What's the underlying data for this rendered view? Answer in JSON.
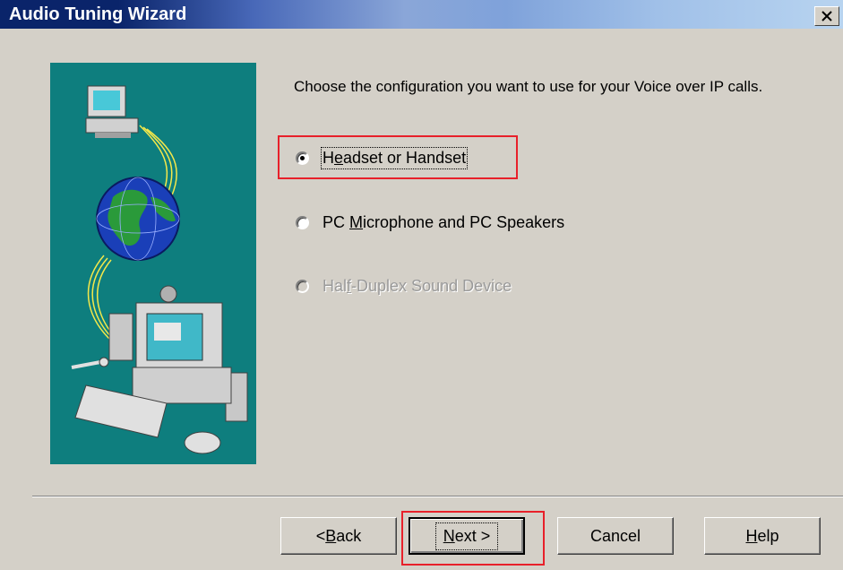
{
  "window": {
    "title": "Audio Tuning Wizard",
    "close_label": "×"
  },
  "instruction": "Choose the configuration you want to use for your Voice over IP calls.",
  "options": [
    {
      "pre": "H",
      "accel": "e",
      "post": "adset or Handset",
      "selected": true,
      "enabled": true
    },
    {
      "pre": "PC ",
      "accel": "M",
      "post": "icrophone and PC Speakers",
      "selected": false,
      "enabled": true
    },
    {
      "pre": "Hal",
      "accel": "f",
      "post": "-Duplex Sound Device",
      "selected": false,
      "enabled": false
    }
  ],
  "buttons": {
    "back": {
      "pre": "< ",
      "accel": "B",
      "post": "ack"
    },
    "next": {
      "pre": "",
      "accel": "N",
      "post": "ext >"
    },
    "cancel": {
      "label": "Cancel"
    },
    "help": {
      "pre": "",
      "accel": "H",
      "post": "elp"
    }
  },
  "colors": {
    "panel": "#0e7e7e",
    "highlight": "#e8202a",
    "title_bar": "#0a246a"
  },
  "illustration": {
    "icons": [
      "computer-icon",
      "globe-icon",
      "multimedia-pc-icon",
      "keyboard-icon",
      "mouse-icon",
      "microphone-icon"
    ]
  }
}
